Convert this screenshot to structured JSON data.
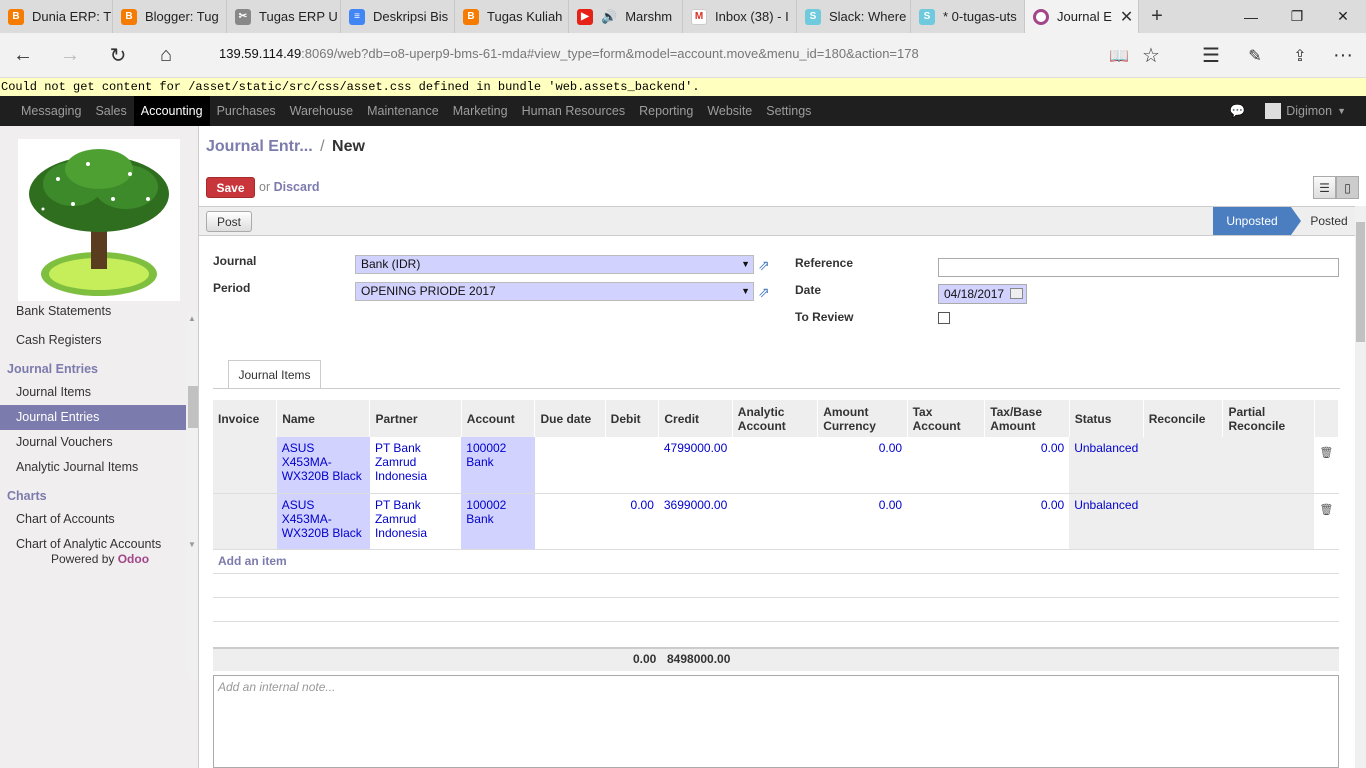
{
  "browser": {
    "tabs": [
      {
        "label": "Dunia ERP: T",
        "color": "#f57c00",
        "icon": "blogger-icon"
      },
      {
        "label": "Blogger: Tug",
        "color": "#f57c00",
        "icon": "blogger-icon"
      },
      {
        "label": "Tugas ERP U",
        "color": "#888888",
        "icon": "scissors-icon"
      },
      {
        "label": "Deskripsi Bis",
        "color": "#4285f4",
        "icon": "layers-icon"
      },
      {
        "label": "Tugas Kuliah",
        "color": "#f57c00",
        "icon": "blogger-icon"
      },
      {
        "label": "Marshm",
        "color": "#e62117",
        "icon": "youtube-icon"
      },
      {
        "label": "Inbox (38) - I",
        "color": "#d93025",
        "icon": "gmail-icon"
      },
      {
        "label": "Slack: Where",
        "color": "#6ecadc",
        "icon": "slack-icon"
      },
      {
        "label": "* 0-tugas-uts",
        "color": "#6ecadc",
        "icon": "slack-icon"
      },
      {
        "label": "Journal E",
        "color": "#a24689",
        "icon": "odoo-icon"
      }
    ],
    "url_host": "139.59.114.49",
    "url_rest": ":8069/web?db=o8-uperp9-bms-61-mda#view_type=form&model=account.move&menu_id=180&action=178"
  },
  "warning": "Could not get content for /asset/static/src/css/asset.css defined in bundle 'web.assets_backend'.",
  "topmenu": {
    "items": [
      "Messaging",
      "Sales",
      "Accounting",
      "Purchases",
      "Warehouse",
      "Maintenance",
      "Marketing",
      "Human Resources",
      "Reporting",
      "Website",
      "Settings"
    ],
    "active": "Accounting",
    "user": "Digimon"
  },
  "sidebar": {
    "items_top": [
      "Bank Statements",
      "Cash Registers"
    ],
    "section_journal": "Journal Entries",
    "journal_items": [
      "Journal Items",
      "Journal Entries",
      "Journal Vouchers",
      "Analytic Journal Items"
    ],
    "active_item": "Journal Entries",
    "section_charts": "Charts",
    "chart_items": [
      "Chart of Accounts",
      "Chart of Analytic Accounts"
    ],
    "powered_by": "Powered by",
    "powered_brand": "Odoo"
  },
  "form": {
    "breadcrumb_parent": "Journal Entr...",
    "breadcrumb_sep": "/",
    "breadcrumb_current": "New",
    "save_label": "Save",
    "or_label": "or",
    "discard_label": "Discard",
    "post_label": "Post",
    "status_unposted": "Unposted",
    "status_posted": "Posted",
    "journal_label": "Journal",
    "journal_value": "Bank (IDR)",
    "period_label": "Period",
    "period_value": "OPENING PRIODE 2017",
    "reference_label": "Reference",
    "reference_value": "",
    "date_label": "Date",
    "date_value": "04/18/2017",
    "to_review_label": "To Review",
    "notebook_tab": "Journal Items",
    "add_item": "Add an item",
    "note_placeholder": "Add an internal note..."
  },
  "table": {
    "headers": [
      "Invoice",
      "Name",
      "Partner",
      "Account",
      "Due date",
      "Debit",
      "Credit",
      "Analytic Account",
      "Amount Currency",
      "Tax Account",
      "Tax/Base Amount",
      "Status",
      "Reconcile",
      "Partial Reconcile"
    ],
    "rows": [
      {
        "invoice": "",
        "name": "ASUS X453MA-WX320B Black",
        "partner": "PT Bank Zamrud Indonesia",
        "account": "100002 Bank",
        "due": "",
        "debit": "",
        "credit": "4799000.00",
        "analytic": "",
        "amount_currency": "0.00",
        "tax_account": "",
        "tax_base": "0.00",
        "status": "Unbalanced",
        "reconcile": "",
        "partial": ""
      },
      {
        "invoice": "",
        "name": "ASUS X453MA-WX320B Black",
        "partner": "PT Bank Zamrud Indonesia",
        "account": "100002 Bank",
        "due": "",
        "debit": "0.00",
        "credit": "3699000.00",
        "analytic": "",
        "amount_currency": "0.00",
        "tax_account": "",
        "tax_base": "0.00",
        "status": "Unbalanced",
        "reconcile": "",
        "partial": ""
      }
    ],
    "total_debit": "0.00",
    "total_credit": "8498000.00"
  }
}
